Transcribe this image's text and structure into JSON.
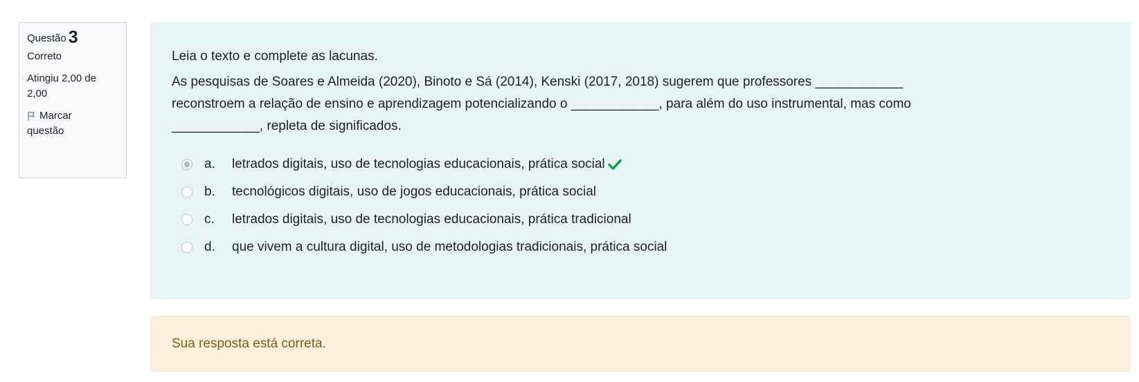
{
  "info": {
    "question_label": "Questão",
    "question_number": "3",
    "state": "Correto",
    "grade_line1": "Atingiu 2,00 de",
    "grade_line2": "2,00",
    "flag_label_line1": "Marcar",
    "flag_label_line2": "questão"
  },
  "question": {
    "intro": "Leia o texto e complete as lacunas.",
    "line1": "As pesquisas de Soares e Almeida (2020), Binoto e Sá (2014), Kenski (2017, 2018) sugerem que professores ____________",
    "line2": "reconstroem a relação de ensino e aprendizagem potencializando o ____________, para além do uso instrumental, mas como",
    "line3": "____________, repleta de significados."
  },
  "answers": [
    {
      "letter": "a.",
      "text": "letrados digitais, uso de tecnologias educacionais, prática social",
      "selected": true,
      "correct": true
    },
    {
      "letter": "b.",
      "text": "tecnológicos digitais, uso de jogos educacionais, prática social",
      "selected": false
    },
    {
      "letter": "c.",
      "text": "letrados digitais, uso de tecnologias educacionais, prática tradicional",
      "selected": false
    },
    {
      "letter": "d.",
      "text": "que vivem a cultura digital, uso de metodologias tradicionais, prática social",
      "selected": false
    }
  ],
  "feedback": {
    "text": "Sua resposta está correta."
  },
  "colors": {
    "content_bg": "#e7f3f5",
    "feedback_bg": "#fcefdc",
    "feedback_text": "#7c5c19",
    "correct_check": "#1f9b4f"
  },
  "icons": {
    "flag": "flag-outline-icon",
    "correct": "checkmark-icon"
  }
}
